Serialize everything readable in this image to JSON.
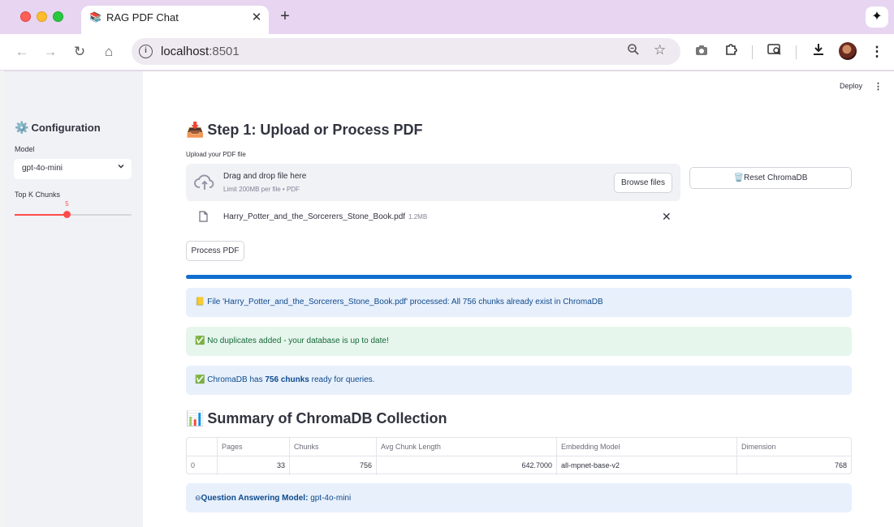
{
  "browser": {
    "tab_title": "RAG PDF Chat",
    "tab_close": "✕",
    "new_tab": "+",
    "url_host": "localhost",
    "url_port": ":8501"
  },
  "header": {
    "deploy_label": "Deploy"
  },
  "sidebar": {
    "title": "Configuration",
    "title_icon": "gear-icon",
    "model_label": "Model",
    "model_value": "gpt-4o-mini",
    "topk_label": "Top K Chunks",
    "topk_value": "5",
    "topk_fraction": 0.45
  },
  "step1": {
    "title": "Step 1: Upload or Process PDF",
    "upload_label": "Upload your PDF file",
    "dropzone_text": "Drag and drop file here",
    "dropzone_limit": "Limit 200MB per file • PDF",
    "browse_label": "Browse files",
    "reset_label": "Reset ChromaDB",
    "file_name": "Harry_Potter_and_the_Sorcerers_Stone_Book.pdf",
    "file_size": "1.2MB",
    "process_label": "Process PDF",
    "progress": 1.0
  },
  "alerts": {
    "processed": "File 'Harry_Potter_and_the_Sorcerers_Stone_Book.pdf' processed: All 756 chunks already exist in ChromaDB",
    "no_duplicates": "No duplicates added - your database is up to date!",
    "chroma_prefix": "ChromaDB has ",
    "chroma_bold": "756 chunks",
    "chroma_suffix": " ready for queries."
  },
  "summary": {
    "title": "Summary of ChromaDB Collection",
    "columns": [
      "",
      "Pages",
      "Chunks",
      "Avg Chunk Length",
      "Embedding Model",
      "Dimension"
    ],
    "rows": [
      [
        "0",
        "33",
        "756",
        "642.7000",
        "all-mpnet-base-v2",
        "768"
      ]
    ]
  },
  "qa": {
    "label": "Question Answering Model:",
    "value": "gpt-4o-mini"
  },
  "colors": {
    "accent": "#ff4b4b",
    "progress": "#0f6fce",
    "info_bg": "#e8f0fc",
    "success_bg": "#e6f6ec"
  }
}
